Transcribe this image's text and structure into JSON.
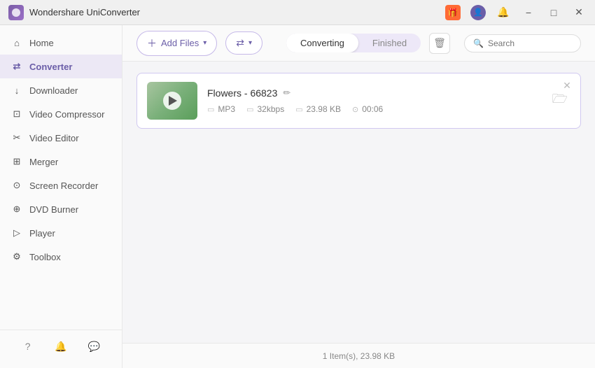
{
  "app": {
    "title": "Wondershare UniConverter",
    "logo_alt": "UniConverter Logo"
  },
  "titlebar": {
    "minimize_label": "−",
    "maximize_label": "□",
    "close_label": "✕",
    "gift_icon": "🎁",
    "user_icon": "👤",
    "bell_icon": "🔔"
  },
  "sidebar": {
    "items": [
      {
        "id": "home",
        "label": "Home",
        "icon": "⌂"
      },
      {
        "id": "converter",
        "label": "Converter",
        "icon": "⇄",
        "active": true
      },
      {
        "id": "downloader",
        "label": "Downloader",
        "icon": "↓"
      },
      {
        "id": "video-compressor",
        "label": "Video Compressor",
        "icon": "⊡"
      },
      {
        "id": "video-editor",
        "label": "Video Editor",
        "icon": "✂"
      },
      {
        "id": "merger",
        "label": "Merger",
        "icon": "⊞"
      },
      {
        "id": "screen-recorder",
        "label": "Screen Recorder",
        "icon": "⊙"
      },
      {
        "id": "dvd-burner",
        "label": "DVD Burner",
        "icon": "⊕"
      },
      {
        "id": "player",
        "label": "Player",
        "icon": "▷"
      },
      {
        "id": "toolbox",
        "label": "Toolbox",
        "icon": "⚙"
      }
    ],
    "bottom_icons": {
      "help": "?",
      "notification": "🔔",
      "feedback": "💬"
    }
  },
  "toolbar": {
    "add_files_label": "Add Files",
    "add_files_icon": "+",
    "convert_icon": "⇄",
    "delete_icon": "🗑",
    "search_placeholder": "Search"
  },
  "tabs": {
    "converting_label": "Converting",
    "finished_label": "Finished",
    "active": "converting"
  },
  "file_card": {
    "name": "Flowers - 66823",
    "format": "MP3",
    "bitrate": "32kbps",
    "size": "23.98 KB",
    "duration": "00:06",
    "close_icon": "✕"
  },
  "status_bar": {
    "text": "1 Item(s), 23.98 KB"
  }
}
